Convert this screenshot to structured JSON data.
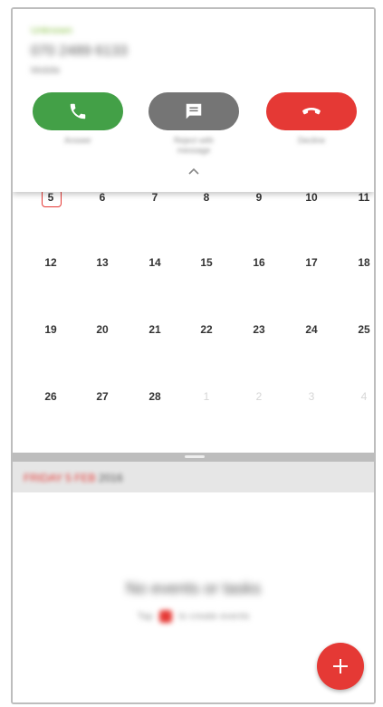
{
  "call": {
    "caller_tag": "Unknown",
    "caller_number": "070 2489 6133",
    "caller_label": "Mobile",
    "answer_label": "Answer",
    "message_label_line1": "Reject with",
    "message_label_line2": "message",
    "decline_label": "Decline",
    "icons": {
      "answer": "phone-icon",
      "message": "message-icon",
      "decline": "hang-up-icon",
      "expand": "chevron-up-icon"
    },
    "colors": {
      "answer": "#43a047",
      "message": "#757575",
      "decline": "#e53935",
      "tag": "#8bc34a"
    }
  },
  "calendar": {
    "weeks": [
      [
        {
          "d": "5",
          "today": true
        },
        {
          "d": "6"
        },
        {
          "d": "7"
        },
        {
          "d": "8"
        },
        {
          "d": "9"
        },
        {
          "d": "10"
        },
        {
          "d": "11"
        }
      ],
      [
        {
          "d": "12"
        },
        {
          "d": "13"
        },
        {
          "d": "14"
        },
        {
          "d": "15"
        },
        {
          "d": "16"
        },
        {
          "d": "17"
        },
        {
          "d": "18"
        }
      ],
      [
        {
          "d": "19"
        },
        {
          "d": "20"
        },
        {
          "d": "21"
        },
        {
          "d": "22"
        },
        {
          "d": "23"
        },
        {
          "d": "24"
        },
        {
          "d": "25"
        }
      ],
      [
        {
          "d": "26"
        },
        {
          "d": "27"
        },
        {
          "d": "28"
        },
        {
          "d": "1",
          "faded": true
        },
        {
          "d": "2",
          "faded": true
        },
        {
          "d": "3",
          "faded": true
        },
        {
          "d": "4",
          "faded": true
        }
      ]
    ],
    "today_color": "#e53935"
  },
  "date_strip": {
    "highlight": "FRIDAY 5 FEB",
    "rest": "2016"
  },
  "events": {
    "empty_title": "No events or tasks",
    "empty_hint_before": "Tap",
    "empty_hint_after": "to create events",
    "fab_icon": "plus-icon",
    "accent": "#e53935"
  }
}
